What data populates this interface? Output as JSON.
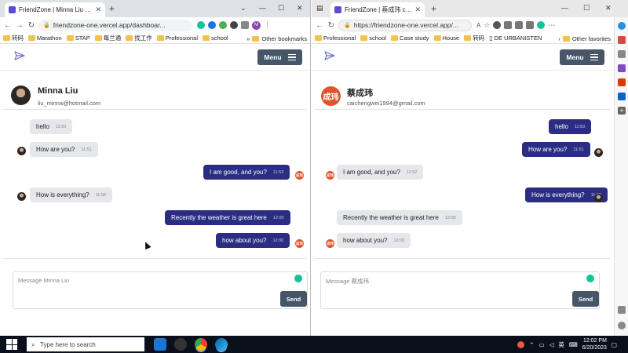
{
  "left_window": {
    "tab_title": "FriendZone | Minna Liu chat",
    "url": "friendzone-one.vercel.app/dashboar...",
    "bookmarks": [
      "转码",
      "Marathon",
      "STAP",
      "每兰通",
      "找工作",
      "Professional",
      "school"
    ],
    "bookmarks_other": "Other bookmarks",
    "menu_label": "Menu",
    "contact": {
      "name": "Minna Liu",
      "email": "liu_minna@hotmail.com"
    },
    "messages": [
      {
        "text": "hello",
        "time": "11:50",
        "dir": "in"
      },
      {
        "text": "How are you?",
        "time": "11:51",
        "dir": "in"
      },
      {
        "text": "I am good, and you?",
        "time": "11:52",
        "dir": "out"
      },
      {
        "text": "How is everything?",
        "time": "11:58",
        "dir": "in"
      },
      {
        "text": "Recently the weather is great here",
        "time": "12:00",
        "dir": "out"
      },
      {
        "text": "how about you?",
        "time": "12:00",
        "dir": "out"
      }
    ],
    "composer_placeholder": "Message Minna Liu",
    "send_label": "Send",
    "avatar_letter": "M"
  },
  "right_window": {
    "tab_title": "FriendZone | 蔡成玮 chat",
    "url": "https://friendzone-one.vercel.app/...",
    "bookmarks": [
      "Professional",
      "school",
      "Case study",
      "House",
      "转码",
      "DE URBANISTEN"
    ],
    "bookmarks_other": "Other favorites",
    "menu_label": "Menu",
    "contact": {
      "name": "蔡成玮",
      "email": "caichengwei1994@gmail.com",
      "badge": "成玮"
    },
    "messages": [
      {
        "text": "hello",
        "time": "11:50",
        "dir": "out"
      },
      {
        "text": "How are you?",
        "time": "11:51",
        "dir": "out"
      },
      {
        "text": "I am good, and you?",
        "time": "11:52",
        "dir": "in"
      },
      {
        "text": "How is everything?",
        "time": "11:58",
        "dir": "out"
      },
      {
        "text": "Recently the weather is great here",
        "time": "12:00",
        "dir": "in"
      },
      {
        "text": "how about you?",
        "time": "12:00",
        "dir": "in"
      }
    ],
    "composer_placeholder": "Message 蔡成玮",
    "send_label": "Send"
  },
  "taskbar": {
    "search_placeholder": "Type here to search",
    "language": "英",
    "time": "12:02 PM",
    "date": "6/20/2023"
  },
  "colors": {
    "outgoing_bubble": "#2b2d83",
    "incoming_bubble": "#e5e7eb",
    "menu_button": "#475569",
    "user_badge": "#e0542c"
  },
  "icons": {
    "logo": "paper-plane-icon",
    "menu": "hamburger-icon",
    "grammarly": "grammarly-icon"
  }
}
